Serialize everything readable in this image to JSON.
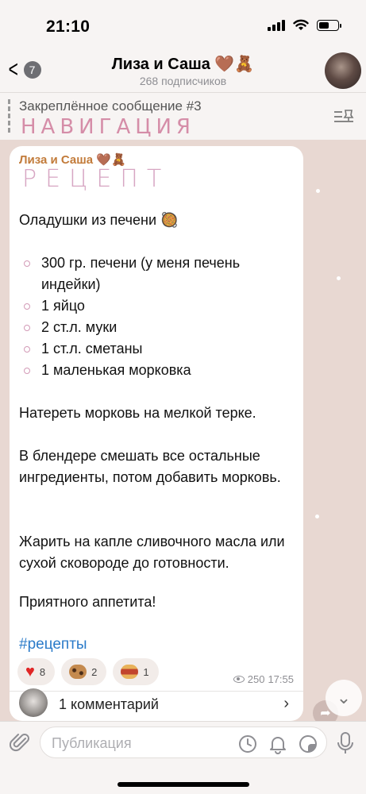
{
  "status_bar": {
    "time": "21:10"
  },
  "header": {
    "back_count": "7",
    "title": "Лиза и Саша 🤎🧸",
    "subtitle": "268 подписчиков"
  },
  "pinned": {
    "title": "Закреплённое сообщение #3",
    "text": "НАВИГАЦИЯ"
  },
  "message": {
    "author": "Лиза и Саша 🤎🧸",
    "heading": "РЕЦЕПТ",
    "title": "Оладушки из печени 🥘",
    "ingredients": [
      "300 гр. печени (у меня печень индейки)",
      "1 яйцо",
      "2 ст.л. муки",
      "1 ст.л. сметаны",
      "1 маленькая морковка"
    ],
    "steps": [
      "Натереть морковь на мелкой терке.",
      "В блендере смешать все остальные ингредиенты, потом добавить морковь.",
      "Жарить на капле сливочного масла или сухой сковороде до готовности.",
      "Приятного аппетита!"
    ],
    "hashtag": "#рецепты",
    "reactions": [
      {
        "emoji": "heart",
        "count": "8"
      },
      {
        "emoji": "cookie",
        "count": "2"
      },
      {
        "emoji": "hotdog",
        "count": "1"
      }
    ],
    "views": "250",
    "time": "17:55",
    "comments_label": "1 комментарий"
  },
  "input": {
    "placeholder": "Публикация"
  },
  "colors": {
    "accent_author": "#c27b3a",
    "hashtag": "#2b7bc9",
    "heading_pink": "#d7a6c3"
  }
}
